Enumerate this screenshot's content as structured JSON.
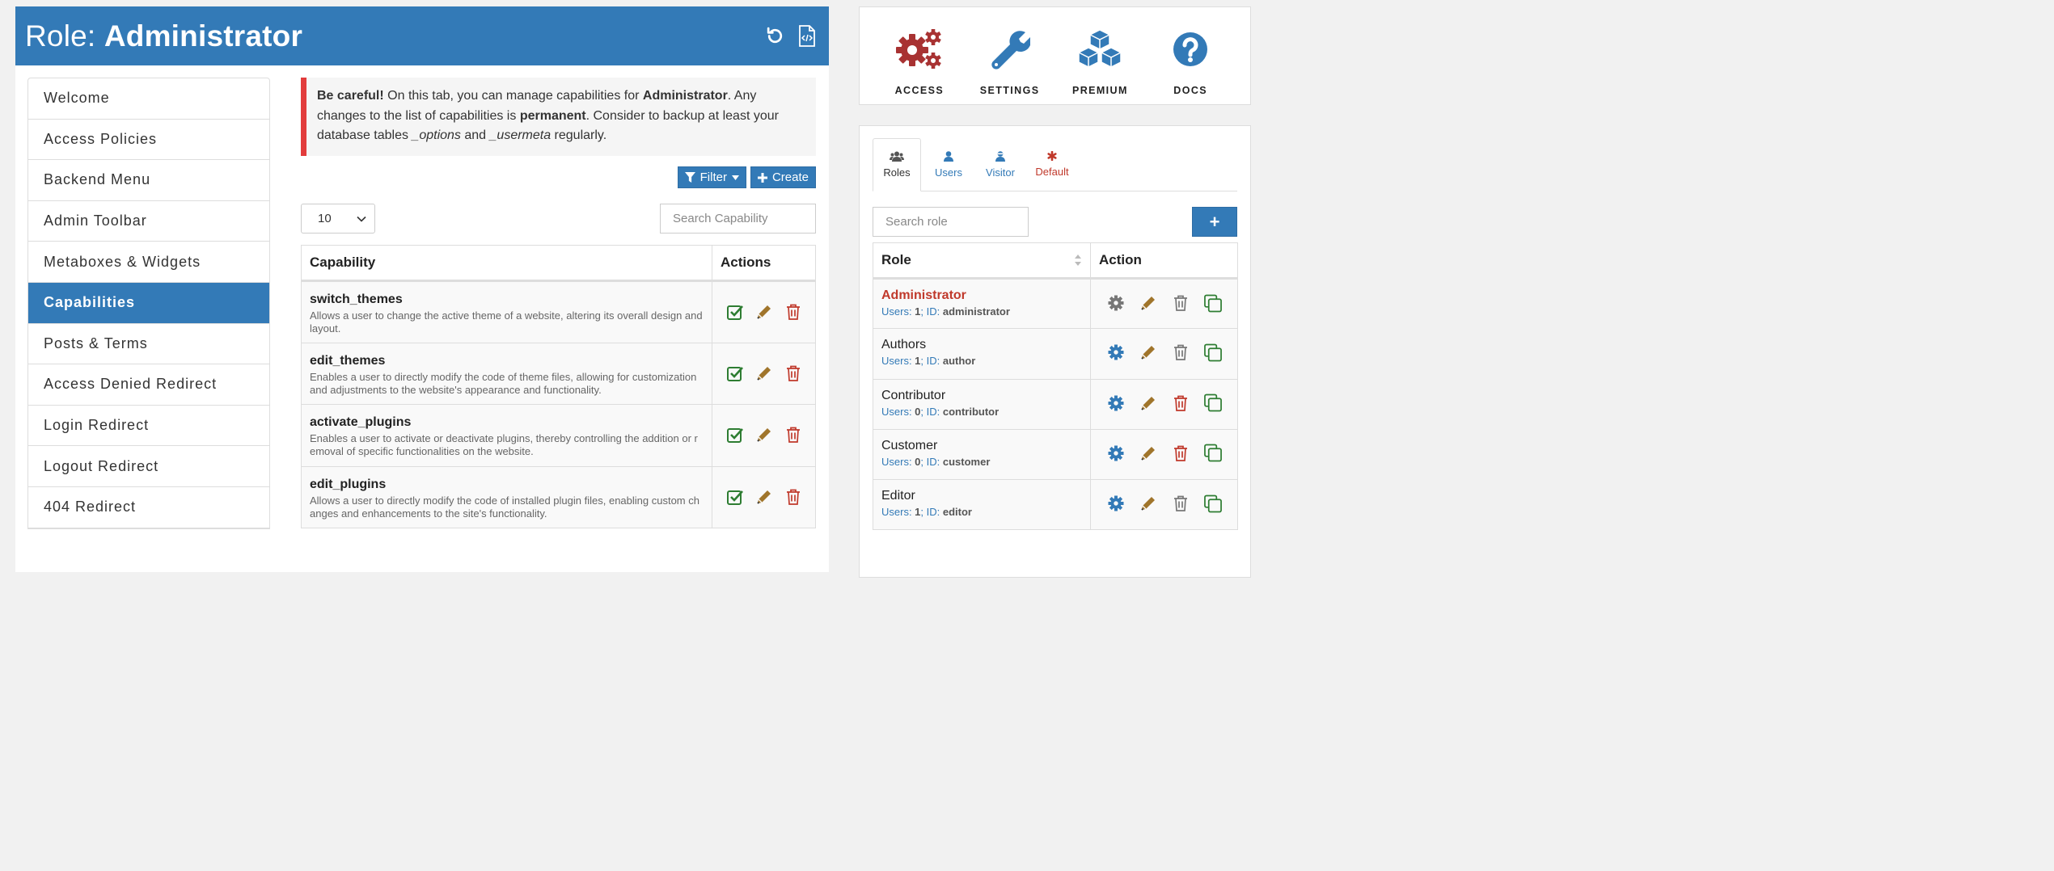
{
  "header": {
    "title_prefix": "Role: ",
    "title_role": "Administrator",
    "reset_icon": "reset-icon",
    "export_icon": "code-file-icon"
  },
  "menu": {
    "items": [
      {
        "label": "Welcome",
        "active": false
      },
      {
        "label": "Access Policies",
        "active": false
      },
      {
        "label": "Backend Menu",
        "active": false
      },
      {
        "label": "Admin Toolbar",
        "active": false
      },
      {
        "label": "Metaboxes & Widgets",
        "active": false
      },
      {
        "label": "Capabilities",
        "active": true
      },
      {
        "label": "Posts & Terms",
        "active": false
      },
      {
        "label": "Access Denied Redirect",
        "active": false
      },
      {
        "label": "Login Redirect",
        "active": false
      },
      {
        "label": "Logout Redirect",
        "active": false
      },
      {
        "label": "404 Redirect",
        "active": false
      }
    ]
  },
  "notice": {
    "strong1": "Be careful!",
    "text1": " On this tab, you can manage capabilities for ",
    "strong2": "Administrator",
    "text2": ". Any changes to the list of capabilities is ",
    "strong3": "permanent",
    "text3": ". Consider to backup at least your database tables ",
    "em1": "_options",
    "text4": " and ",
    "em2": "_usermeta",
    "text5": " regularly."
  },
  "toolbar": {
    "filter_label": "Filter",
    "create_label": "Create"
  },
  "controls": {
    "page_size": "10",
    "search_placeholder": "Search Capability"
  },
  "cap_table": {
    "col_capability": "Capability",
    "col_actions": "Actions",
    "rows": [
      {
        "name": "switch_themes",
        "desc": "Allows a user to change the active theme of a website, altering its overall design and layout."
      },
      {
        "name": "edit_themes",
        "desc": "Enables a user to directly modify the code of theme files, allowing for customization and adjustments to the website's appearance and functionality."
      },
      {
        "name": "activate_plugins",
        "desc": "Enables a user to activate or deactivate plugins, thereby controlling the addition or removal of specific functionalities on the website."
      },
      {
        "name": "edit_plugins",
        "desc": "Allows a user to directly modify the code of installed plugin files, enabling custom changes and enhancements to the site's functionality."
      }
    ]
  },
  "top_card": {
    "items": [
      {
        "label": "ACCESS",
        "icon": "gears-icon"
      },
      {
        "label": "SETTINGS",
        "icon": "wrench-icon"
      },
      {
        "label": "PREMIUM",
        "icon": "cubes-icon"
      },
      {
        "label": "DOCS",
        "icon": "question-circle-icon"
      }
    ]
  },
  "tabs": [
    {
      "label": "Roles",
      "icon": "users-icon",
      "active": true
    },
    {
      "label": "Users",
      "icon": "user-icon",
      "active": false
    },
    {
      "label": "Visitor",
      "icon": "visitor-icon",
      "active": false
    },
    {
      "label": "Default",
      "icon": "asterisk-icon",
      "active": false
    }
  ],
  "roles_panel": {
    "search_placeholder": "Search role",
    "add_label": "+",
    "col_role": "Role",
    "col_action": "Action",
    "users_label": "Users: ",
    "id_label": "; ID: ",
    "rows": [
      {
        "name": "Administrator",
        "users": "1",
        "id": "administrator",
        "current": true
      },
      {
        "name": "Authors",
        "users": "1",
        "id": "author",
        "current": false
      },
      {
        "name": "Contributor",
        "users": "0",
        "id": "contributor",
        "current": false
      },
      {
        "name": "Customer",
        "users": "0",
        "id": "customer",
        "current": false
      },
      {
        "name": "Editor",
        "users": "1",
        "id": "editor",
        "current": false
      }
    ]
  },
  "colors": {
    "primary": "#337ab7",
    "danger": "#c0392b",
    "success": "#2e7d32",
    "edit": "#a0752b",
    "muted": "#777777"
  }
}
